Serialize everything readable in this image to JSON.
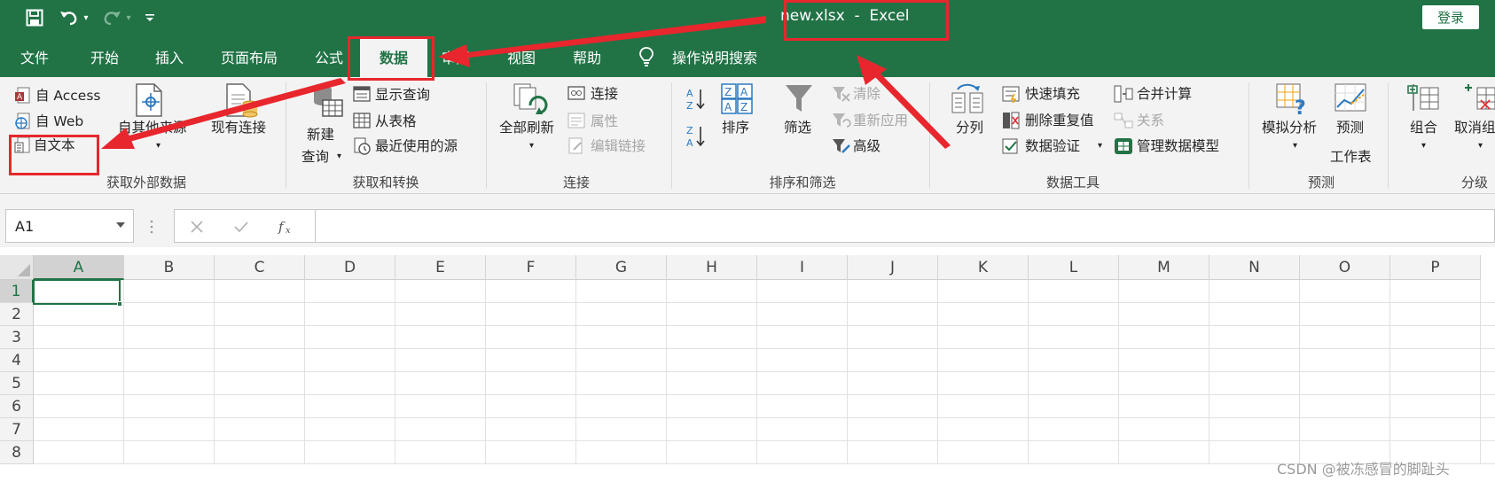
{
  "quick_access": {
    "save_icon": "save-icon",
    "undo_icon": "undo-icon",
    "redo_icon": "redo-icon",
    "customize_icon": "customize-qat-icon"
  },
  "window": {
    "title": "new.xlsx  -  Excel",
    "login_label": "登录"
  },
  "tabs": [
    {
      "label": "文件"
    },
    {
      "label": "开始"
    },
    {
      "label": "插入"
    },
    {
      "label": "页面布局"
    },
    {
      "label": "公式"
    },
    {
      "label": "数据",
      "active": true
    },
    {
      "label": "审阅"
    },
    {
      "label": "视图"
    },
    {
      "label": "帮助"
    },
    {
      "label": "操作说明搜索"
    }
  ],
  "ribbon": {
    "get_external": {
      "from_access": "自 Access",
      "from_web": "自 Web",
      "from_text": "自文本",
      "from_other": "自其他来源",
      "existing_connections": "现有连接",
      "group_label": "获取外部数据"
    },
    "get_transform": {
      "new_query_1": "新建",
      "new_query_2": "查询",
      "show_queries": "显示查询",
      "from_table": "从表格",
      "recent_sources": "最近使用的源",
      "group_label": "获取和转换"
    },
    "connections": {
      "refresh_all": "全部刷新",
      "connections": "连接",
      "properties": "属性",
      "edit_links": "编辑链接",
      "group_label": "连接"
    },
    "sort_filter": {
      "sort": "排序",
      "filter": "筛选",
      "clear": "清除",
      "reapply": "重新应用",
      "advanced": "高级",
      "group_label": "排序和筛选"
    },
    "data_tools": {
      "text_to_columns": "分列",
      "flash_fill": "快速填充",
      "remove_duplicates": "删除重复值",
      "data_validation": "数据验证",
      "consolidate": "合并计算",
      "relationships": "关系",
      "manage_model": "管理数据模型",
      "group_label": "数据工具"
    },
    "forecast": {
      "what_if": "模拟分析",
      "forecast_sheet_1": "预测",
      "forecast_sheet_2": "工作表",
      "group_label": "预测"
    },
    "outline": {
      "group": "组合",
      "ungroup": "取消组",
      "group_label": "分级"
    }
  },
  "formula_bar": {
    "name_box": "A1",
    "formula": ""
  },
  "columns": [
    "A",
    "B",
    "C",
    "D",
    "E",
    "F",
    "G",
    "H",
    "I",
    "J",
    "K",
    "L",
    "M",
    "N",
    "O",
    "P"
  ],
  "rows": [
    "1",
    "2",
    "3",
    "4",
    "5",
    "6",
    "7",
    "8"
  ],
  "watermark": "CSDN @被冻感冒的脚趾头",
  "colors": {
    "excel_green": "#217346",
    "ribbon_bg": "#f3f3f3",
    "annotation_red": "#e8262d"
  }
}
